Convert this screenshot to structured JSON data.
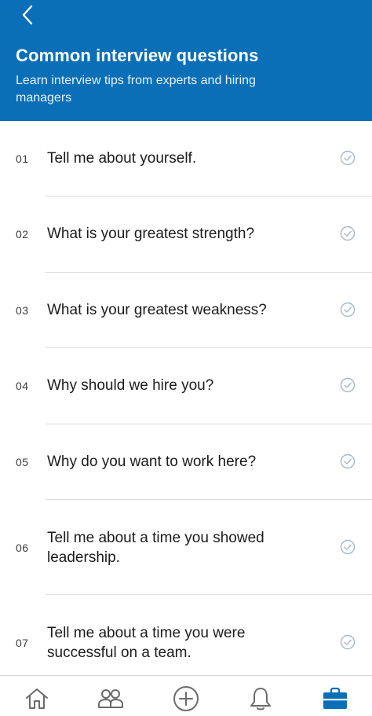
{
  "colors": {
    "accent": "#0a6fb7",
    "check": "#a9b8c4",
    "tab_inactive": "#6b6b6b",
    "tab_active": "#0a6fb7"
  },
  "header": {
    "back_icon": "chevron-left-icon",
    "title": "Common interview questions",
    "subtitle": "Learn interview tips from experts and hiring managers"
  },
  "questions": [
    {
      "number": "01",
      "text": "Tell me about yourself."
    },
    {
      "number": "02",
      "text": "What is your greatest strength?"
    },
    {
      "number": "03",
      "text": "What is your greatest weakness?"
    },
    {
      "number": "04",
      "text": "Why should we hire you?"
    },
    {
      "number": "05",
      "text": "Why do you want to work here?"
    },
    {
      "number": "06",
      "text": "Tell me about a time you showed leadership."
    },
    {
      "number": "07",
      "text": "Tell me about a time you were successful on a team."
    }
  ],
  "tabbar": {
    "tabs": [
      {
        "icon": "home-icon",
        "active": false
      },
      {
        "icon": "people-icon",
        "active": false
      },
      {
        "icon": "add-circle-icon",
        "active": false
      },
      {
        "icon": "bell-icon",
        "active": false
      },
      {
        "icon": "briefcase-icon",
        "active": true
      }
    ]
  }
}
